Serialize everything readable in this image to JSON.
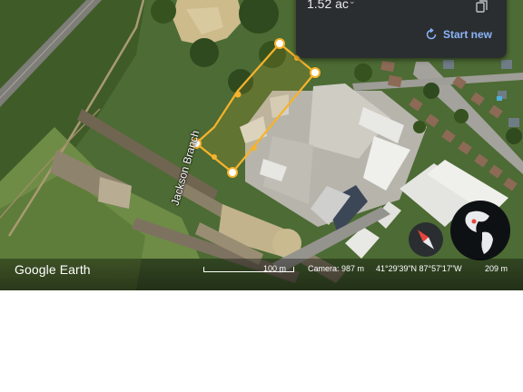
{
  "measure_panel": {
    "area_value": "1.52 ac",
    "area_unit_chevron": "⌄",
    "copy_icon": "copy-icon",
    "start_new_label": "Start new",
    "start_new_icon": "refresh-icon",
    "accent_color": "#8ab4f8"
  },
  "map": {
    "road_label": "Jackson Branch",
    "measure_line_color": "#f6b32b"
  },
  "info_bar": {
    "brand": "Google Earth",
    "scale_label": "100 m",
    "camera": "Camera: 987 m",
    "coordinates": "41°29'39\"N 87°57'17\"W",
    "elevation": "209 m"
  },
  "controls": {
    "compass_icon": "compass-icon",
    "globe_icon": "globe-icon"
  }
}
